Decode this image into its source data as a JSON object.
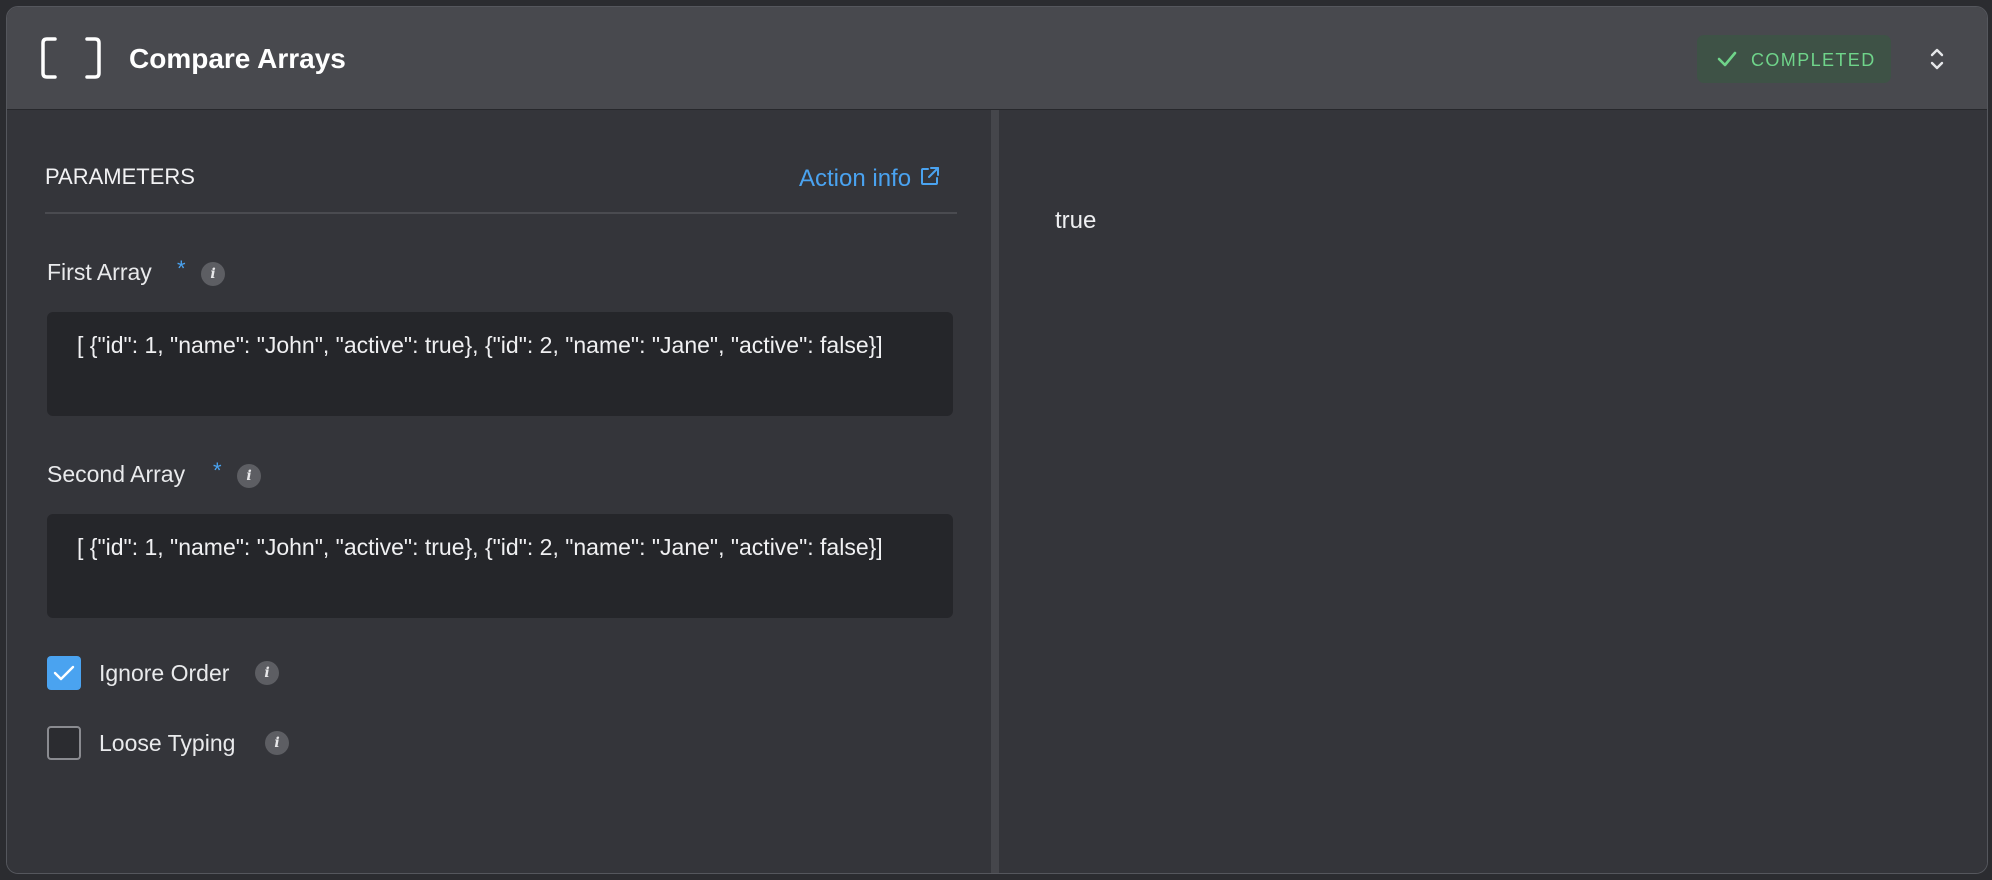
{
  "header": {
    "title": "Compare Arrays",
    "icon": "brackets-icon",
    "status": "COMPLETED",
    "status_color": "#6fd48a",
    "expand_icon": "chevron-up-down-icon"
  },
  "parameters": {
    "heading": "PARAMETERS",
    "action_info_label": "Action info",
    "accent": "#4aa3f0",
    "first_array": {
      "label": "First Array",
      "required_mark": "*",
      "value": "[ {\"id\": 1, \"name\": \"John\", \"active\": true}, {\"id\": 2, \"name\": \"Jane\", \"active\": false}]"
    },
    "second_array": {
      "label": "Second Array",
      "required_mark": "*",
      "value": "[ {\"id\": 1, \"name\": \"John\", \"active\": true}, {\"id\": 2, \"name\": \"Jane\", \"active\": false}]"
    },
    "ignore_order": {
      "label": "Ignore Order",
      "checked": true
    },
    "loose_typing": {
      "label": "Loose Typing",
      "checked": false
    },
    "info_glyph": "i"
  },
  "result": {
    "value": "true"
  }
}
